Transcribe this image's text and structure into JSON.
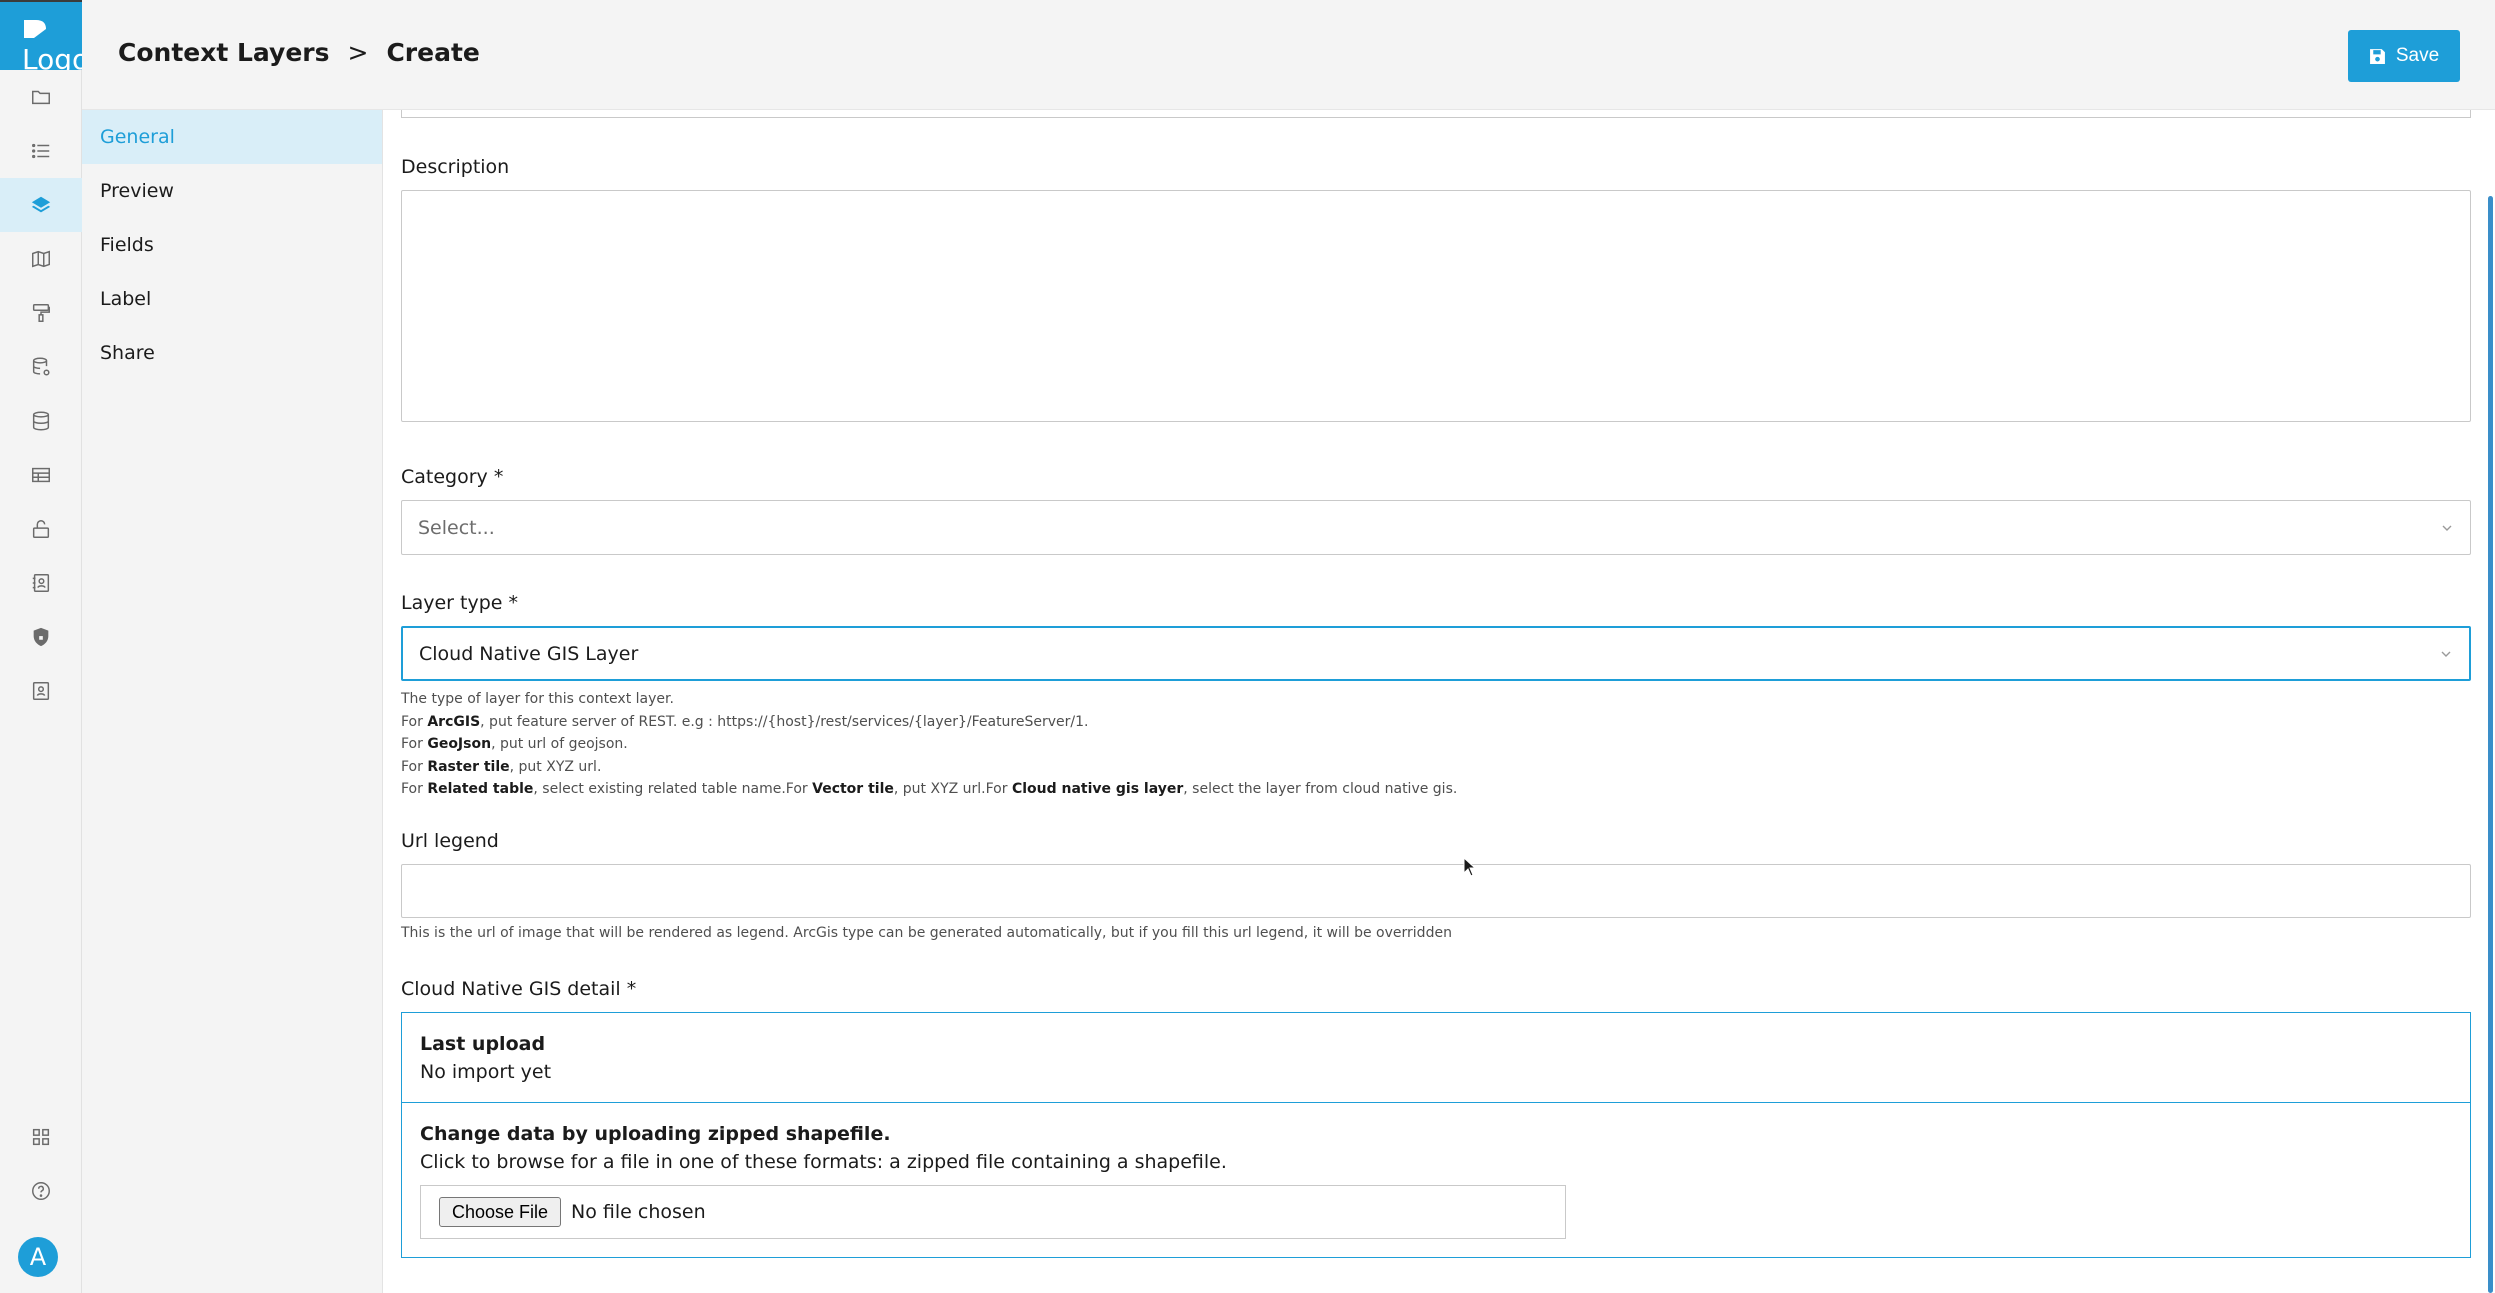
{
  "app": {
    "logo_text": "Logo"
  },
  "breadcrumb": {
    "parent": "Context Layers",
    "separator": ">",
    "current": "Create"
  },
  "toolbar": {
    "save_label": "Save"
  },
  "rail": {
    "icons": [
      "folder-icon",
      "list-icon",
      "layers-icon",
      "map-icon",
      "paint-roller-icon",
      "database-settings-icon",
      "database-icon",
      "table-icon",
      "unlock-icon",
      "contact-book-icon",
      "shield-icon",
      "contact-card-icon",
      "apps-grid-icon",
      "help-icon"
    ],
    "active": "layers-icon",
    "avatar_letter": "A"
  },
  "section_nav": {
    "items": [
      {
        "label": "General",
        "active": true
      },
      {
        "label": "Preview",
        "active": false
      },
      {
        "label": "Fields",
        "active": false
      },
      {
        "label": "Label",
        "active": false
      },
      {
        "label": "Share",
        "active": false
      }
    ]
  },
  "form": {
    "description": {
      "label": "Description",
      "value": ""
    },
    "category": {
      "label": "Category",
      "required_mark": "*",
      "placeholder": "Select..."
    },
    "layer_type": {
      "label": "Layer type",
      "required_mark": "*",
      "value": "Cloud Native GIS Layer",
      "help": {
        "line1": "The type of layer for this context layer.",
        "line2_prefix": "For ",
        "line2_bold": "ArcGIS",
        "line2_rest": ", put feature server of REST. e.g : https://{host}/rest/services/{layer}/FeatureServer/1.",
        "line3_prefix": "For ",
        "line3_bold": "GeoJson",
        "line3_rest": ", put url of geojson.",
        "line4_prefix": "For ",
        "line4_bold": "Raster tile",
        "line4_rest": ", put XYZ url.",
        "line5_prefix": "For ",
        "line5_bold1": "Related table",
        "line5_mid1": ", select existing related table name.For ",
        "line5_bold2": "Vector tile",
        "line5_mid2": ", put XYZ url.For ",
        "line5_bold3": "Cloud native gis layer",
        "line5_rest": ", select the layer from cloud native gis."
      }
    },
    "url_legend": {
      "label": "Url legend",
      "value": "",
      "help": "This is the url of image that will be rendered as legend. ArcGis type can be generated automatically, but if you fill this url legend, it will be overridden"
    },
    "cloud_native_detail": {
      "label": "Cloud Native GIS detail",
      "required_mark": "*",
      "last_upload_title": "Last upload",
      "last_upload_value": "No import yet",
      "change_title": "Change data by uploading zipped shapefile.",
      "change_text": "Click to browse for a file in one of these formats: a zipped file containing a shapefile.",
      "choose_file_label": "Choose File",
      "file_status": "No file chosen"
    }
  },
  "colors": {
    "accent": "#1e9ed8",
    "nav_active_bg": "#d9eef8",
    "panel_bg": "#f4f4f4"
  }
}
